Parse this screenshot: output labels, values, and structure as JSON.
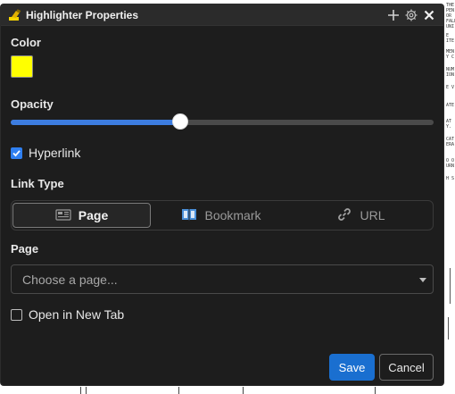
{
  "dialog": {
    "title": "Highlighter Properties",
    "title_icon": "highlighter-icon",
    "titlebar_buttons": [
      "plus-icon",
      "gear-icon",
      "close-icon"
    ]
  },
  "color": {
    "label": "Color",
    "value": "#ffff00"
  },
  "opacity": {
    "label": "Opacity",
    "value_fraction": 0.4
  },
  "hyperlink": {
    "label": "Hyperlink",
    "checked": true
  },
  "link_type": {
    "label": "Link Type",
    "options": [
      {
        "label": "Page",
        "icon": "page-icon",
        "selected": true
      },
      {
        "label": "Bookmark",
        "icon": "bookmark-icon",
        "selected": false
      },
      {
        "label": "URL",
        "icon": "link-icon",
        "selected": false
      }
    ]
  },
  "page": {
    "label": "Page",
    "placeholder": "Choose a page..."
  },
  "open_new_tab": {
    "label": "Open in New Tab",
    "checked": false
  },
  "buttons": {
    "save": "Save",
    "cancel": "Cancel"
  },
  "colors": {
    "accent": "#3d7de0",
    "save_button": "#1a6fd0",
    "dialog_bg": "#1d1d1d"
  }
}
